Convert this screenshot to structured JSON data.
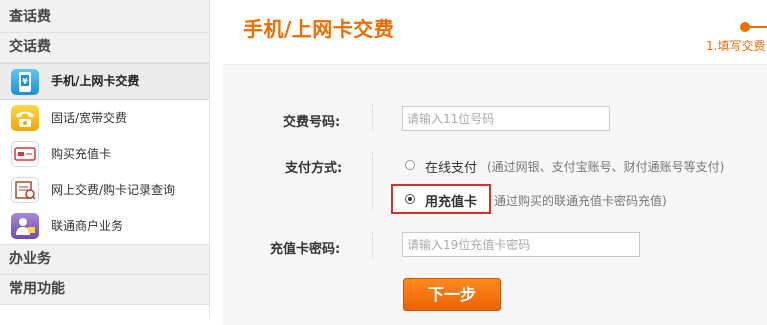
{
  "sidebar": {
    "sections": {
      "query": "查话费",
      "pay": "交话费",
      "business": "办业务",
      "common": "常用功能"
    },
    "items": [
      {
        "label": "手机/上网卡交费",
        "icon": "mobile-yen-icon",
        "active": true
      },
      {
        "label": "固话/宽带交费",
        "icon": "telephone-icon",
        "active": false
      },
      {
        "label": "购买充值卡",
        "icon": "card-icon",
        "active": false
      },
      {
        "label": "网上交费/购卡记录查询",
        "icon": "records-icon",
        "active": false
      },
      {
        "label": "联通商户业务",
        "icon": "merchant-icon",
        "active": false
      }
    ]
  },
  "main": {
    "title": "手机/上网卡交费",
    "step": "1.填写交费"
  },
  "form": {
    "phone_label": "交费号码:",
    "phone_placeholder": "请输入11位号码",
    "pay_method_label": "支付方式:",
    "option_online": "在线支付",
    "option_online_note": "(通过网银、支付宝账号、财付通账号等支付)",
    "option_card": "用充值卡",
    "option_card_note": "通过购买的联通充值卡密码充值)",
    "selected_option": "用充值卡",
    "card_pwd_label": "充值卡密码:",
    "card_pwd_placeholder": "请输入19位充值卡密码",
    "next_button": "下一步"
  },
  "colors": {
    "accent": "#f06c00",
    "highlight": "#d9302a"
  }
}
